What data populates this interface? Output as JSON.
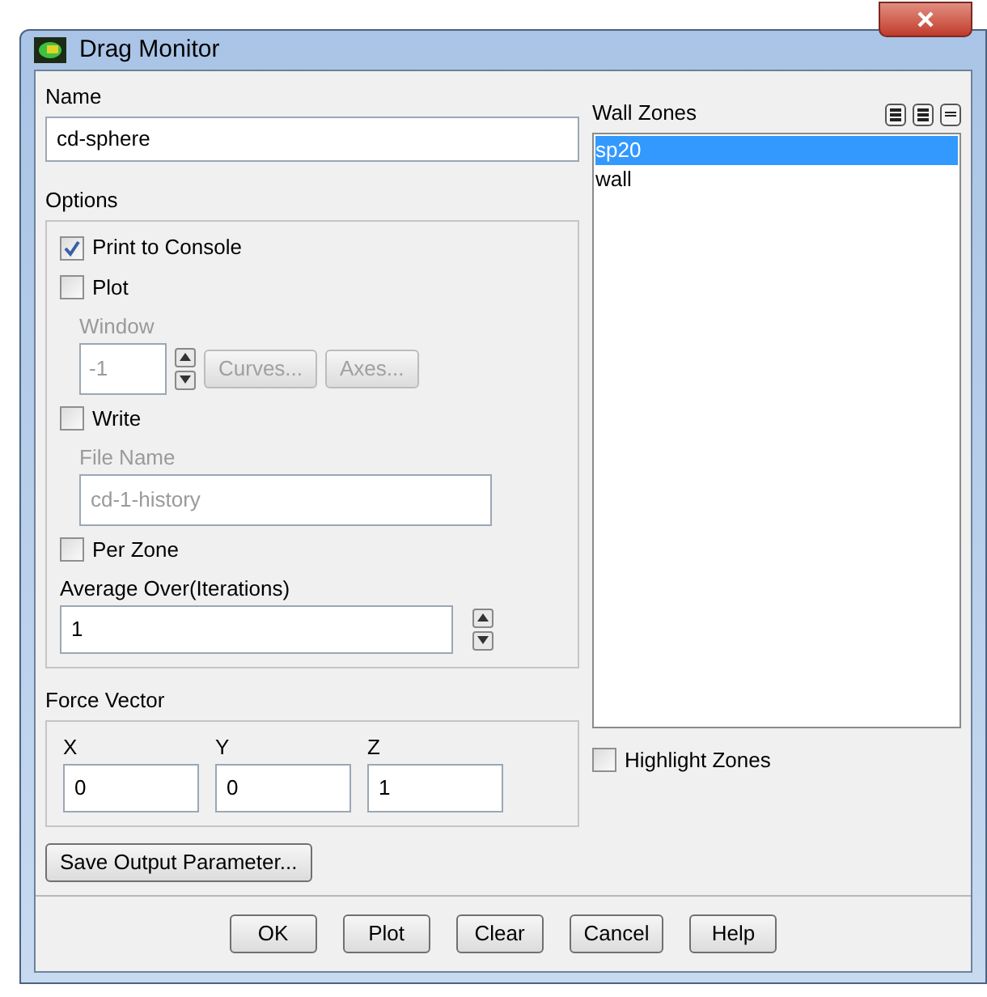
{
  "window": {
    "title": "Drag Monitor"
  },
  "name": {
    "label": "Name",
    "value": "cd-sphere"
  },
  "options": {
    "label": "Options",
    "print_to_console": {
      "label": "Print to Console",
      "checked": true
    },
    "plot": {
      "label": "Plot",
      "checked": false
    },
    "window_field": {
      "label": "Window",
      "value": "-1",
      "disabled": true
    },
    "curves_button": {
      "label": "Curves...",
      "disabled": true
    },
    "axes_button": {
      "label": "Axes...",
      "disabled": true
    },
    "write": {
      "label": "Write",
      "checked": false
    },
    "file_name": {
      "label": "File Name",
      "value": "cd-1-history",
      "disabled": true
    },
    "per_zone": {
      "label": "Per Zone",
      "checked": false
    },
    "average_over": {
      "label": "Average Over(Iterations)",
      "value": "1"
    }
  },
  "force_vector": {
    "label": "Force Vector",
    "components": [
      {
        "label": "X",
        "value": "0"
      },
      {
        "label": "Y",
        "value": "0"
      },
      {
        "label": "Z",
        "value": "1"
      }
    ]
  },
  "save_button": "Save Output Parameter...",
  "wall_zones": {
    "label": "Wall Zones",
    "items": [
      {
        "label": "sp20",
        "selected": true
      },
      {
        "label": "wall",
        "selected": false
      }
    ]
  },
  "highlight_zones": {
    "label": "Highlight Zones",
    "checked": false
  },
  "buttons": [
    "OK",
    "Plot",
    "Clear",
    "Cancel",
    "Help"
  ]
}
